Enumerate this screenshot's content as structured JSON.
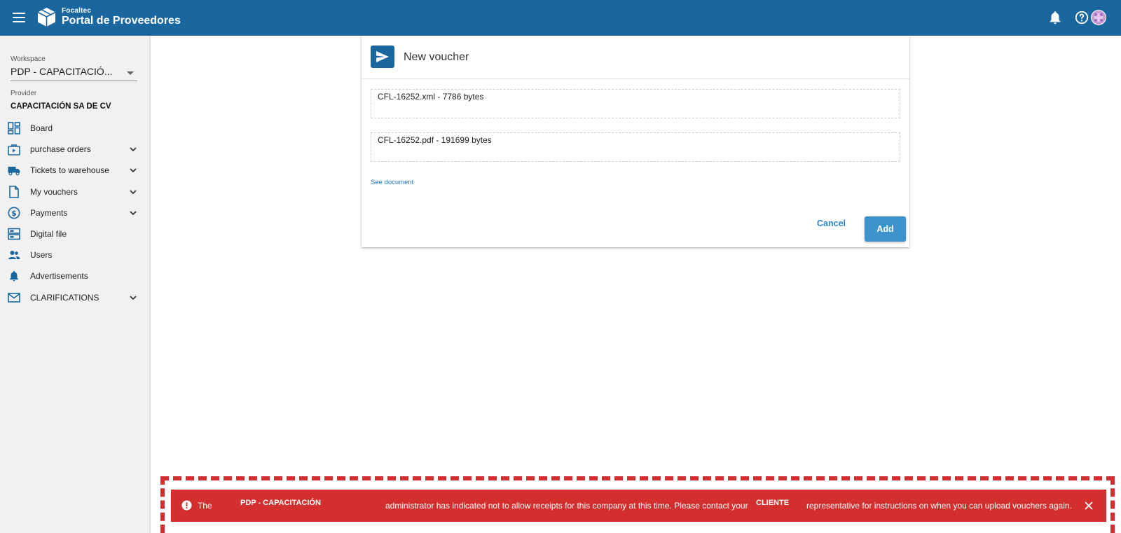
{
  "app": {
    "brand_small": "Focaltec",
    "brand_title": "Portal de Proveedores"
  },
  "sidebar": {
    "workspace_label": "Workspace",
    "workspace_value": "PDP - CAPACITACIÓ...",
    "provider_label": "Provider",
    "provider_value": "CAPACITACIÓN SA DE CV",
    "items": [
      {
        "label": "Board",
        "icon": "dashboard-icon",
        "expandable": false
      },
      {
        "label": "purchase orders",
        "icon": "shopping-bag-icon",
        "expandable": true
      },
      {
        "label": "Tickets to warehouse",
        "icon": "truck-icon",
        "expandable": true
      },
      {
        "label": "My vouchers",
        "icon": "document-icon",
        "expandable": true
      },
      {
        "label": "Payments",
        "icon": "dollar-circle-icon",
        "expandable": true
      },
      {
        "label": "Digital file",
        "icon": "archive-icon",
        "expandable": false
      },
      {
        "label": "Users",
        "icon": "users-icon",
        "expandable": false
      },
      {
        "label": "Advertisements",
        "icon": "bell-icon",
        "expandable": false
      },
      {
        "label": "CLARIFICATIONS",
        "icon": "mail-icon",
        "expandable": true
      }
    ]
  },
  "dialog": {
    "title": "New voucher",
    "files": [
      "CFL-16252.xml - 7786 bytes",
      "CFL-16252.pdf - 191699 bytes"
    ],
    "see_document": "See document",
    "cancel_label": "Cancel",
    "add_label": "Add"
  },
  "alert": {
    "part1": "The",
    "workspace": "PDP - CAPACITACIÓN",
    "part2": "administrator has indicated not to allow receipts for this company at this time. Please contact your",
    "client": "CLIENTE",
    "part3": "representative for instructions on when you can upload vouchers again.",
    "color": "#d32f2f"
  },
  "colors": {
    "primary": "#1a67a0",
    "accent": "#3d93cc",
    "link": "#1a73c8"
  }
}
